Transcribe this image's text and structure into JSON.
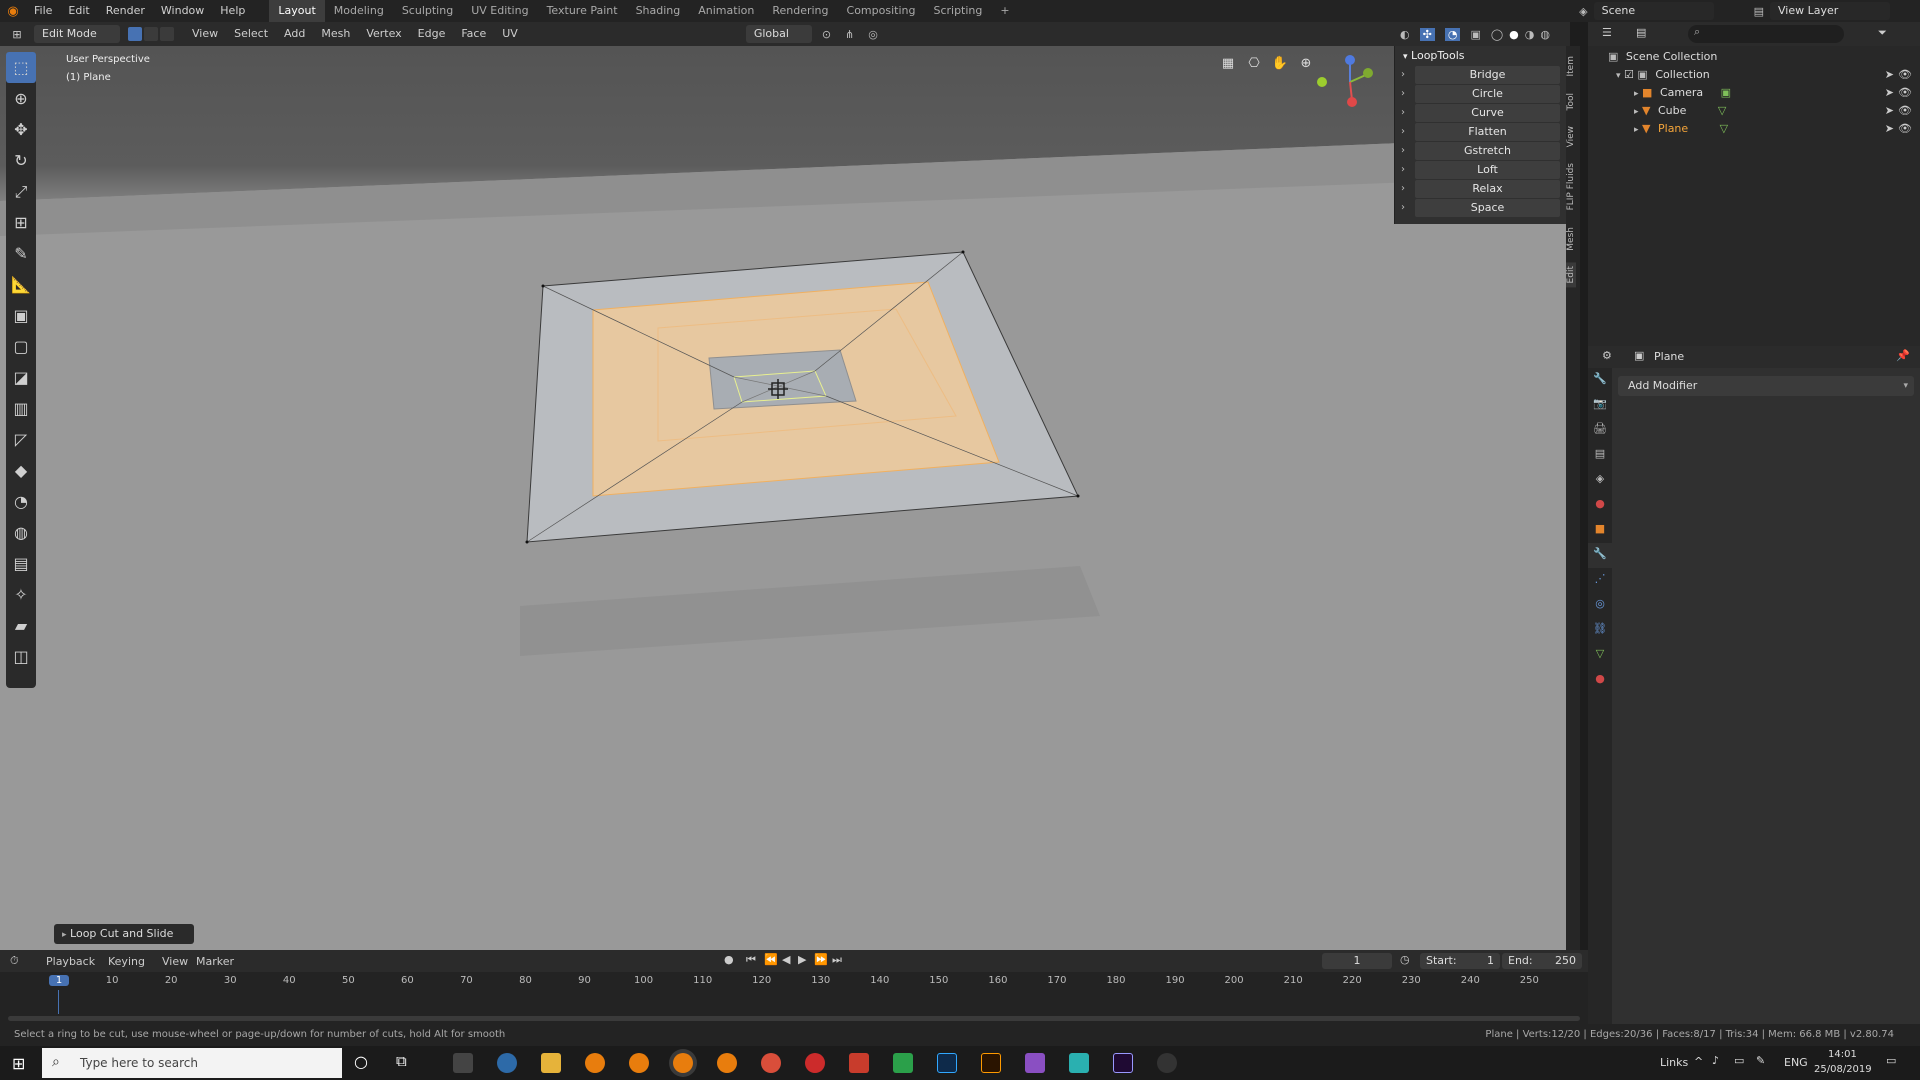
{
  "topbar": {
    "menus": [
      "File",
      "Edit",
      "Render",
      "Window",
      "Help"
    ],
    "workspaces": [
      "Layout",
      "Modeling",
      "Sculpting",
      "UV Editing",
      "Texture Paint",
      "Shading",
      "Animation",
      "Rendering",
      "Compositing",
      "Scripting"
    ],
    "active_workspace": "Layout",
    "add_tab": "+",
    "scene_label": "Scene",
    "view_layer_label": "View Layer"
  },
  "viewport_header": {
    "mode": "Edit Mode",
    "menus": [
      "View",
      "Select",
      "Add",
      "Mesh",
      "Vertex",
      "Edge",
      "Face",
      "UV"
    ],
    "orientation": "Global"
  },
  "viewport": {
    "perspective": "User Perspective",
    "object": "(1) Plane",
    "operator_panel": "Loop Cut and Slide"
  },
  "looptools": {
    "title": "LoopTools",
    "items": [
      "Bridge",
      "Circle",
      "Curve",
      "Flatten",
      "Gstretch",
      "Loft",
      "Relax",
      "Space"
    ]
  },
  "side_tabs": [
    "Item",
    "Tool",
    "View",
    "FLIP Fluids",
    "Mesh",
    "Edit"
  ],
  "outliner": {
    "root": "Scene Collection",
    "collection": "Collection",
    "items": [
      {
        "name": "Camera",
        "color": "#dcdcdc"
      },
      {
        "name": "Cube",
        "color": "#dcdcdc"
      },
      {
        "name": "Plane",
        "color": "#f5a53a"
      }
    ]
  },
  "properties": {
    "object_name": "Plane",
    "add_modifier": "Add Modifier"
  },
  "timeline": {
    "menus": [
      "Playback",
      "Keying",
      "View",
      "Marker"
    ],
    "current_frame": "1",
    "start_label": "Start:",
    "start_value": "1",
    "end_label": "End:",
    "end_value": "250",
    "ticks": [
      "1",
      "10",
      "20",
      "30",
      "40",
      "50",
      "60",
      "70",
      "80",
      "90",
      "100",
      "110",
      "120",
      "130",
      "140",
      "150",
      "160",
      "170",
      "180",
      "190",
      "200",
      "210",
      "220",
      "230",
      "240",
      "250"
    ]
  },
  "statusbar": {
    "hint": "Select a ring to be cut, use mouse-wheel or page-up/down for number of cuts, hold Alt for smooth",
    "stats": "Plane | Verts:12/20 | Edges:20/36 | Faces:8/17 | Tris:34 | Mem: 66.8 MB | v2.80.74"
  },
  "taskbar": {
    "search_placeholder": "Type here to search",
    "links": "Links",
    "lang": "ENG",
    "time": "14:01",
    "date": "25/08/2019"
  },
  "colors": {
    "accent": "#4772b3",
    "selection": "#f5a53a"
  }
}
